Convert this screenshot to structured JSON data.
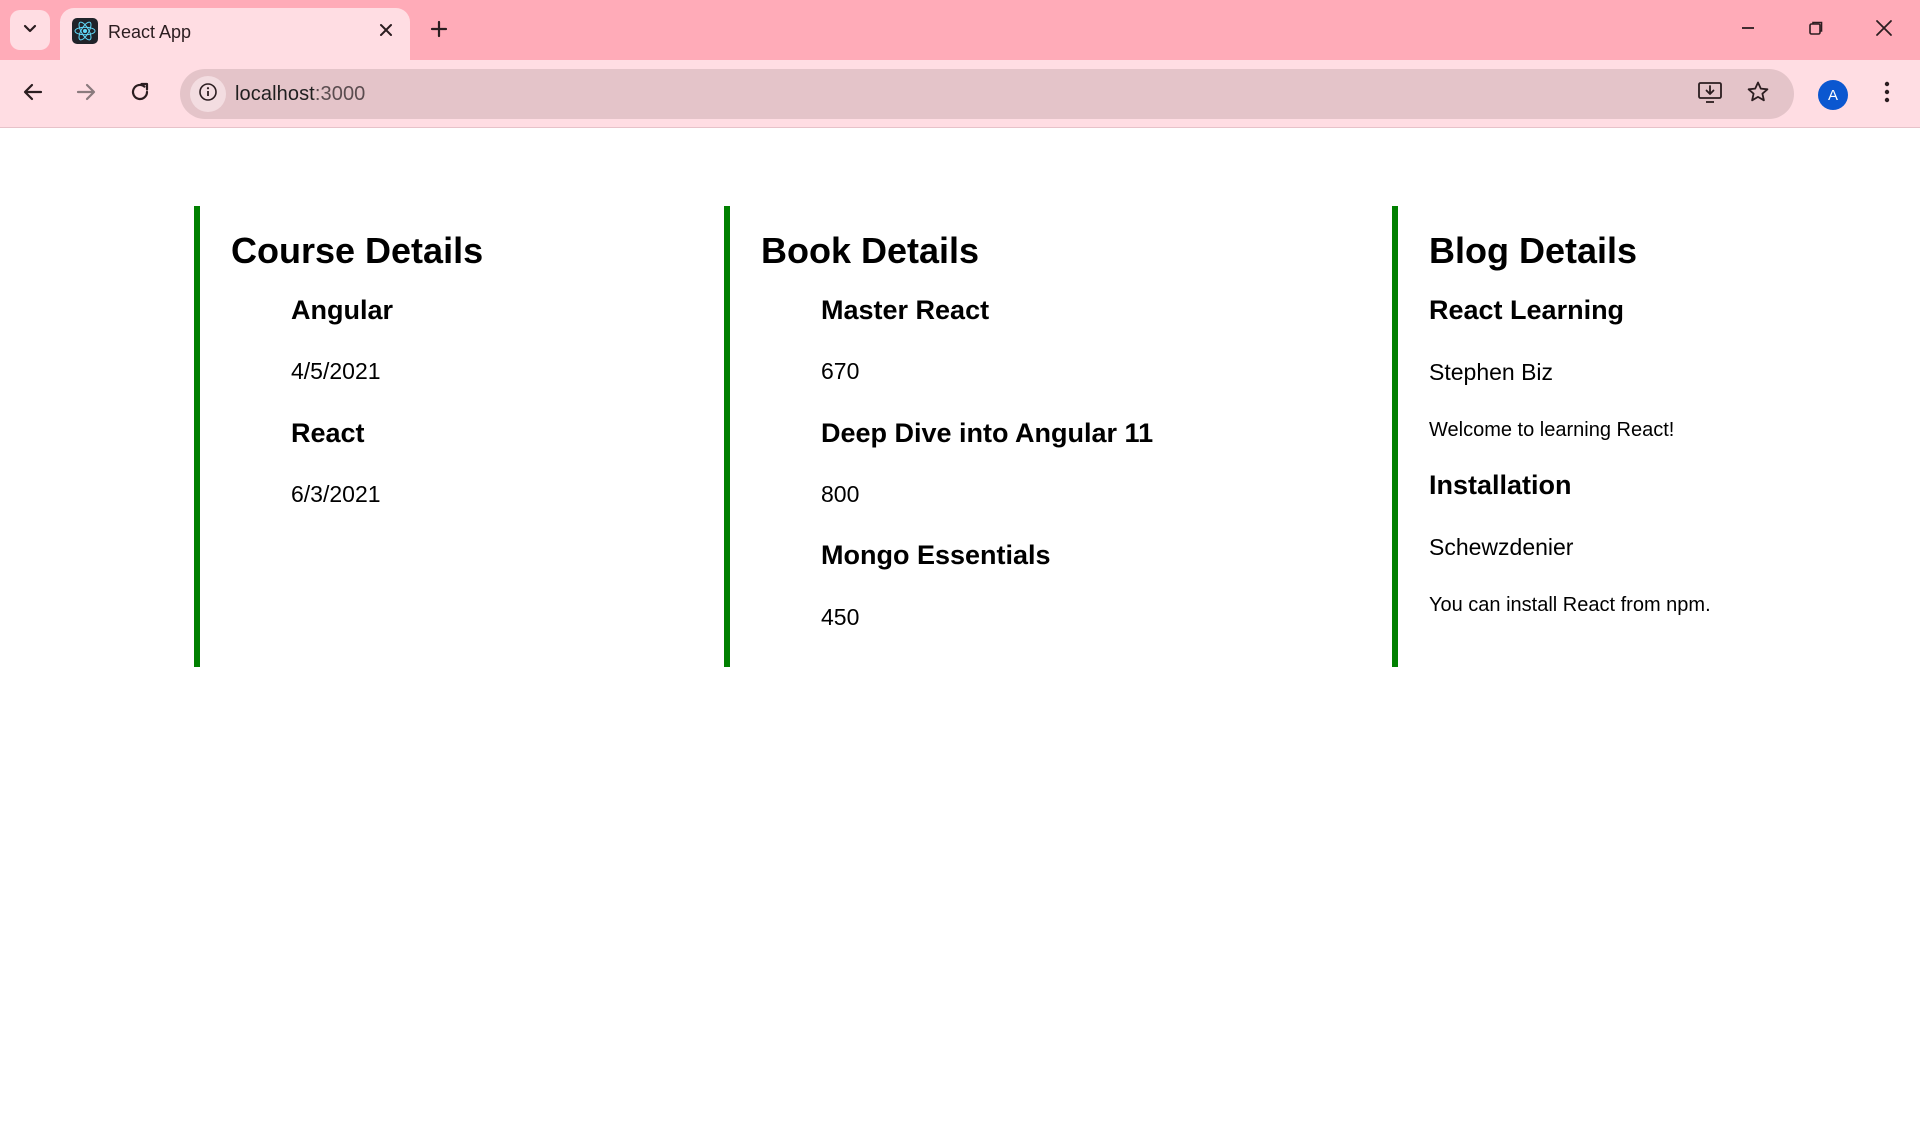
{
  "browser": {
    "tab_title": "React App",
    "url_host": "localhost",
    "url_port": ":3000",
    "avatar_letter": "A",
    "theme_colors": {
      "tabbar": "#ffabb8",
      "toolbar": "#ffdde3",
      "omnibox": "#e4c4c9",
      "avatar": "#0b57d0"
    }
  },
  "page": {
    "accent_color": "#008000",
    "course": {
      "heading": "Course Details",
      "items": [
        {
          "name": "Angular",
          "date": "4/5/2021"
        },
        {
          "name": "React",
          "date": "6/3/2021"
        }
      ]
    },
    "book": {
      "heading": "Book Details",
      "items": [
        {
          "name": "Master React",
          "price": "670"
        },
        {
          "name": "Deep Dive into Angular 11",
          "price": "800"
        },
        {
          "name": "Mongo Essentials",
          "price": "450"
        }
      ]
    },
    "blog": {
      "heading": "Blog Details",
      "items": [
        {
          "title": "React Learning",
          "author": "Stephen Biz",
          "content": "Welcome to learning React!"
        },
        {
          "title": "Installation",
          "author": "Schewzdenier",
          "content": "You can install React from npm."
        }
      ]
    }
  }
}
